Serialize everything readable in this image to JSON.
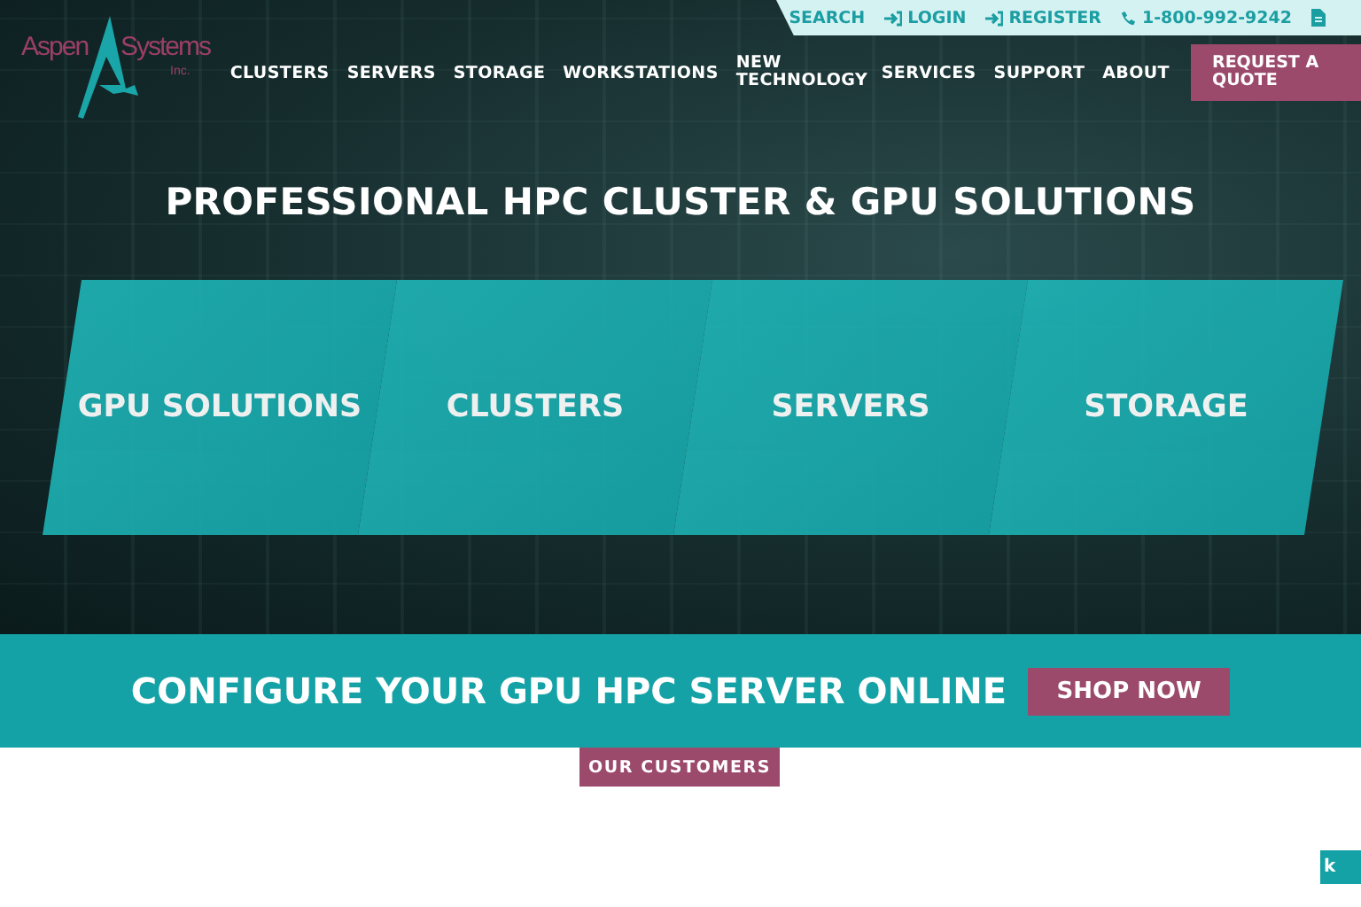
{
  "utility_bar": [
    {
      "kind": "search",
      "label": "SEARCH"
    },
    {
      "kind": "login",
      "label": "LOGIN"
    },
    {
      "kind": "login",
      "label": "REGISTER"
    },
    {
      "kind": "phone",
      "label": "1-800-992-9242"
    },
    {
      "kind": "document"
    }
  ],
  "logo": {
    "left": "Aspen",
    "right": "Systems",
    "sub": "Inc."
  },
  "nav": [
    "CLUSTERS",
    "SERVERS",
    "STORAGE",
    "WORKSTATIONS",
    "NEW TECHNOLOGY",
    "SERVICES",
    "SUPPORT",
    "ABOUT"
  ],
  "quote_button": "REQUEST A QUOTE",
  "hero_title": "PROFESSIONAL HPC CLUSTER & GPU SOLUTIONS",
  "tiles": [
    "GPU SOLUTIONS",
    "CLUSTERS",
    "SERVERS",
    "STORAGE"
  ],
  "band": {
    "text": "CONFIGURE YOUR GPU HPC SERVER ONLINE",
    "button": "SHOP NOW"
  },
  "customers_label": "OUR CUSTOMERS",
  "side_tab": "k"
}
